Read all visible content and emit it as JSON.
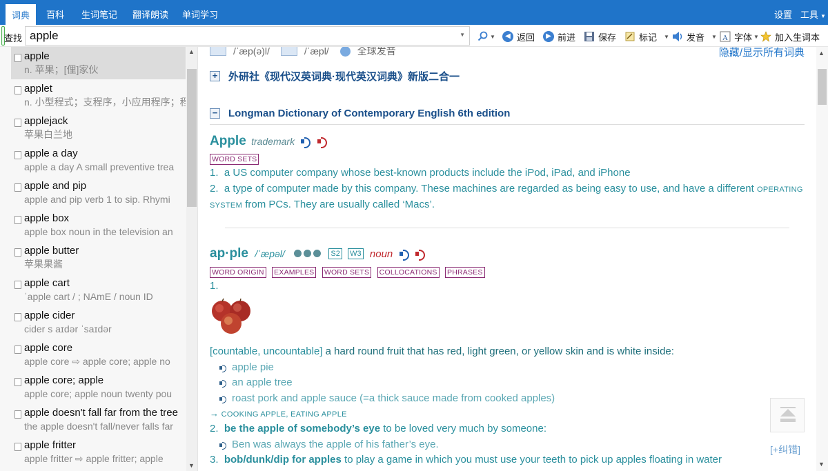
{
  "nav": {
    "tabs": [
      "词典",
      "百科",
      "生词笔记",
      "翻译朗读",
      "单词学习"
    ],
    "active_tab": 0,
    "settings": "设置",
    "tools": "工具"
  },
  "search": {
    "label": "查找",
    "value": "apple"
  },
  "toolbar": {
    "back": "返回",
    "forward": "前进",
    "save": "保存",
    "mark": "标记",
    "pronounce": "发音",
    "font": "字体",
    "add_wordbook": "加入生词本"
  },
  "results": [
    {
      "word": "apple",
      "def": "n. 苹果；[俚]家伙"
    },
    {
      "word": "applet",
      "def": "n. 小型程式；支程序，小应用程序；程"
    },
    {
      "word": "applejack",
      "def": "苹果白兰地"
    },
    {
      "word": "apple a day",
      "def": "apple a day A small preventive trea"
    },
    {
      "word": "apple and pip",
      "def": "apple and pip   verb 1 to sip. Rhymi"
    },
    {
      "word": "apple box",
      "def": "apple box noun in the television an"
    },
    {
      "word": "apple butter",
      "def": "苹果果酱"
    },
    {
      "word": "apple cart",
      "def": "ˈapple cart  / ;   NAmE /     noun    ID"
    },
    {
      "word": "apple cider",
      "def": "cider       s   aɪdər              ˈsaɪdər"
    },
    {
      "word": "apple core",
      "def": "apple core  ⇨ apple core; apple   no"
    },
    {
      "word": "apple core; apple",
      "def": "apple core; apple noun twenty pou"
    },
    {
      "word": "apple doesn't fall far from the tree",
      "def": "the apple doesn't fall/never falls far"
    },
    {
      "word": "apple fritter",
      "def": "apple fritter  ⇨ apple fritter; apple"
    }
  ],
  "content": {
    "pron_uk": "/ˈæp(ə)l/",
    "pron_us": "/ˈæpl/",
    "global_pron": "全球发音",
    "toggle_dicts": "隐藏/显示所有词典",
    "dict1": "外研社《现代汉英词典·现代英汉词典》新版二合一",
    "dict2": "Longman Dictionary of Contemporary English 6th edition",
    "entry1": {
      "headword": "Apple",
      "label": "trademark",
      "tag": "WORD SETS",
      "sense1_num": "1.",
      "sense1": "a US computer company whose best-known products include the iPod, iPad, and iPhone",
      "sense2_num": "2.",
      "sense2_a": "a type of computer made by this company. These machines are regarded as being easy to use, and have a different",
      "sense2_sc1": "OPERATING",
      "sense2_sc2": "SYSTEM",
      "sense2_b": "from PCs. They are usually called ‘Macs’."
    },
    "entry2": {
      "headword": "ap·ple",
      "pron": "/ˈæpəl/",
      "freq_s": "S2",
      "freq_w": "W3",
      "pos": "noun",
      "tags": [
        "WORD ORIGIN",
        "EXAMPLES",
        "WORD SETS",
        "COLLOCATIONS",
        "PHRASES"
      ],
      "sense1_num": "1.",
      "sense1_gram": "[countable, uncountable]",
      "sense1_def": "a hard round fruit that has red, light green, or yellow skin and is white inside:",
      "examples": [
        "apple pie",
        "an apple tree",
        "roast pork and apple sauce (=a thick sauce made from cooked apples)"
      ],
      "crossref_arrow": "→",
      "crossref": "COOKING APPLE, EATING APPLE",
      "sense2_num": "2.",
      "sense2_phrase": "be the apple of somebody’s eye",
      "sense2_def": "to be loved very much by someone:",
      "sense2_example": "Ben was always the apple of his father’s eye.",
      "sense3_num": "3.",
      "sense3_phrase": "bob/dunk/dip for apples",
      "sense3_def": "to play a game in which you must use your teeth to pick up apples floating in water"
    },
    "correction": "[+纠错]"
  }
}
